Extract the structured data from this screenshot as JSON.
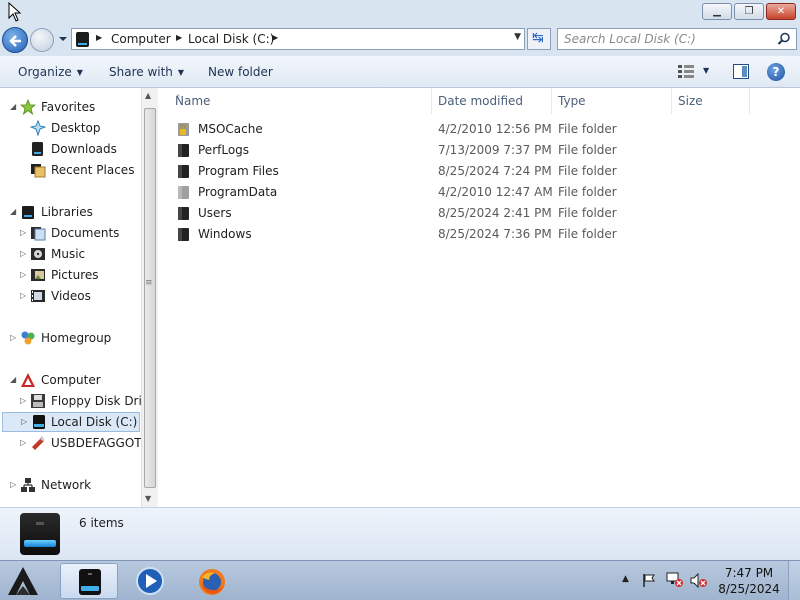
{
  "address": {
    "crumbs": [
      "Computer",
      "Local Disk (C:)"
    ]
  },
  "search": {
    "placeholder": "Search Local Disk (C:)"
  },
  "toolbar": {
    "organize": "Organize",
    "share_with": "Share with",
    "new_folder": "New folder"
  },
  "nav": {
    "favorites": "Favorites",
    "desktop": "Desktop",
    "downloads": "Downloads",
    "recent_places": "Recent Places",
    "libraries": "Libraries",
    "documents": "Documents",
    "music": "Music",
    "pictures": "Pictures",
    "videos": "Videos",
    "homegroup": "Homegroup",
    "computer": "Computer",
    "floppy": "Floppy Disk Drive",
    "local_disk": "Local Disk (C:)",
    "usb": "USBDEFAGGOT (",
    "network": "Network"
  },
  "columns": {
    "name": "Name",
    "date": "Date modified",
    "type": "Type",
    "size": "Size"
  },
  "files": [
    {
      "name": "MSOCache",
      "date": "4/2/2010 12:56 PM",
      "type": "File folder",
      "icon": "locked-folder-icon"
    },
    {
      "name": "PerfLogs",
      "date": "7/13/2009 7:37 PM",
      "type": "File folder",
      "icon": "folder-icon"
    },
    {
      "name": "Program Files",
      "date": "8/25/2024 7:24 PM",
      "type": "File folder",
      "icon": "folder-icon"
    },
    {
      "name": "ProgramData",
      "date": "4/2/2010 12:47 AM",
      "type": "File folder",
      "icon": "hidden-folder-icon"
    },
    {
      "name": "Users",
      "date": "8/25/2024 2:41 PM",
      "type": "File folder",
      "icon": "folder-icon"
    },
    {
      "name": "Windows",
      "date": "8/25/2024 7:36 PM",
      "type": "File folder",
      "icon": "folder-icon"
    }
  ],
  "details": {
    "count": "6 items"
  },
  "taskbar": {
    "time": "7:47 PM",
    "date": "8/25/2024"
  }
}
